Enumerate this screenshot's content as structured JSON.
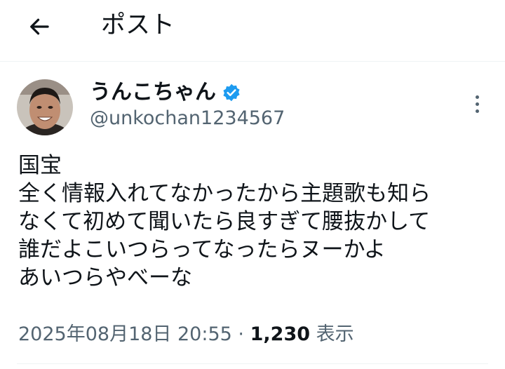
{
  "header": {
    "title": "ポスト",
    "back_icon": "arrow-left-icon"
  },
  "author": {
    "display_name": "うんこちゃん",
    "handle": "@unkochan1234567",
    "verified": true,
    "verified_color": "#1d9bf0"
  },
  "tweet": {
    "lines": [
      "国宝",
      "全く情報入れてなかったから主題歌も知ら",
      "なくて初めて聞いたら良すぎて腰抜かして",
      "誰だよこいつらってなったらヌーかよ",
      "あいつらやべーな"
    ],
    "timestamp": "2025年08月18日 20:55",
    "separator": "·",
    "views_count": "1,230",
    "views_label": "表示"
  },
  "colors": {
    "text_primary": "#0f1419",
    "text_secondary": "#536471",
    "divider": "#eff3f4"
  }
}
